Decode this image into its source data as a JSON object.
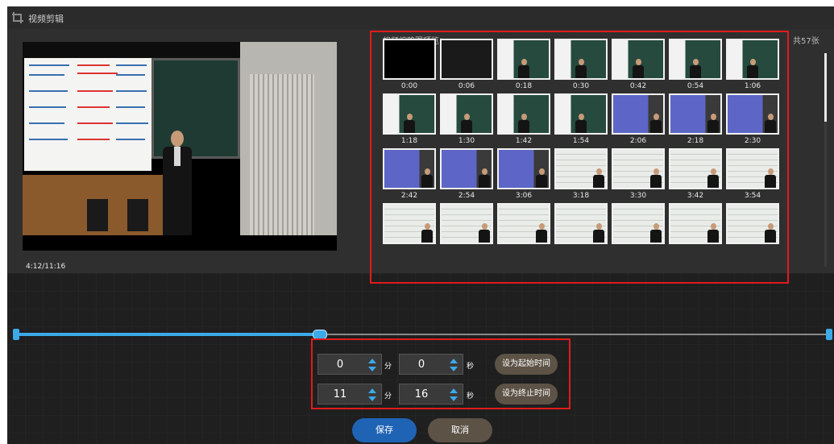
{
  "window": {
    "title": "视频剪辑",
    "icon": "crop-icon"
  },
  "player": {
    "time_readout": "4:12/11:16"
  },
  "thumbnails": {
    "title": "视频缩略图预览：",
    "total_count": "共57张",
    "items": [
      {
        "time": "0:00",
        "scene": "black"
      },
      {
        "time": "0:06",
        "scene": "dark"
      },
      {
        "time": "0:18",
        "scene": "board"
      },
      {
        "time": "0:30",
        "scene": "board"
      },
      {
        "time": "0:42",
        "scene": "board"
      },
      {
        "time": "0:54",
        "scene": "board"
      },
      {
        "time": "1:06",
        "scene": "board"
      },
      {
        "time": "1:18",
        "scene": "board"
      },
      {
        "time": "1:30",
        "scene": "board"
      },
      {
        "time": "1:42",
        "scene": "board"
      },
      {
        "time": "1:54",
        "scene": "board"
      },
      {
        "time": "2:06",
        "scene": "slide"
      },
      {
        "time": "2:18",
        "scene": "slide"
      },
      {
        "time": "2:30",
        "scene": "slide"
      },
      {
        "time": "2:42",
        "scene": "slide"
      },
      {
        "time": "2:54",
        "scene": "slide"
      },
      {
        "time": "3:06",
        "scene": "slide"
      },
      {
        "time": "3:18",
        "scene": "white"
      },
      {
        "time": "3:30",
        "scene": "white"
      },
      {
        "time": "3:42",
        "scene": "white"
      },
      {
        "time": "3:54",
        "scene": "white"
      },
      {
        "time": "",
        "scene": "white"
      },
      {
        "time": "",
        "scene": "white"
      },
      {
        "time": "",
        "scene": "white"
      },
      {
        "time": "",
        "scene": "white"
      },
      {
        "time": "",
        "scene": "white"
      },
      {
        "time": "",
        "scene": "white"
      },
      {
        "time": "",
        "scene": "white"
      }
    ]
  },
  "timeline": {
    "start_fraction": 0.0,
    "end_fraction": 1.0,
    "playhead_fraction": 0.3725
  },
  "range": {
    "start": {
      "minutes": "0",
      "seconds": "0"
    },
    "end": {
      "minutes": "11",
      "seconds": "16"
    },
    "minute_unit": "分",
    "second_unit": "秒",
    "set_start_label": "设为起始时间",
    "set_end_label": "设为终止时间"
  },
  "actions": {
    "save_label": "保存",
    "cancel_label": "取消"
  },
  "colors": {
    "accent": "#3ca9e8",
    "primary_button": "#1f63b5",
    "highlight": "#e11b1b"
  }
}
